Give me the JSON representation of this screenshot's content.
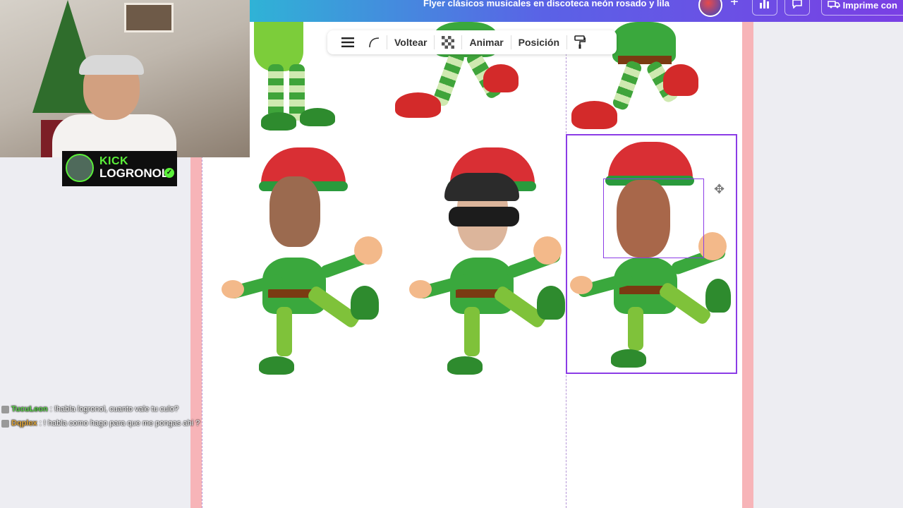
{
  "header": {
    "doc_title": "Flyer clásicos musicales en discoteca neón rosado y lila",
    "print_label": "Imprime con",
    "icons": [
      "user-avatar",
      "plus-icon",
      "bar-chart-icon",
      "comment-icon",
      "truck-icon"
    ]
  },
  "toolbar": {
    "items": [
      {
        "icon": "menu-icon"
      },
      {
        "icon": "corner-radius-icon"
      },
      {
        "label": "Voltear"
      },
      {
        "icon": "transparency-icon"
      },
      {
        "label": "Animar"
      },
      {
        "label": "Posición"
      },
      {
        "icon": "paint-roller-icon"
      }
    ]
  },
  "overlay": {
    "platform": "KICK",
    "channel": "LOGRONOL"
  },
  "chat": [
    {
      "user": "TucuLeon",
      "user_color": "#5bd34a",
      "message": ": !habla logronol, cuanto vale tu culo?"
    },
    {
      "user": "Dqplex",
      "user_color": "#e0a63a",
      "message": ": ! habla como hago para que me pongas ahi ?"
    }
  ],
  "colors": {
    "accent_selection": "#8b3ce6",
    "bleed": "#f7b4b8",
    "kick_green": "#5bf03a"
  }
}
